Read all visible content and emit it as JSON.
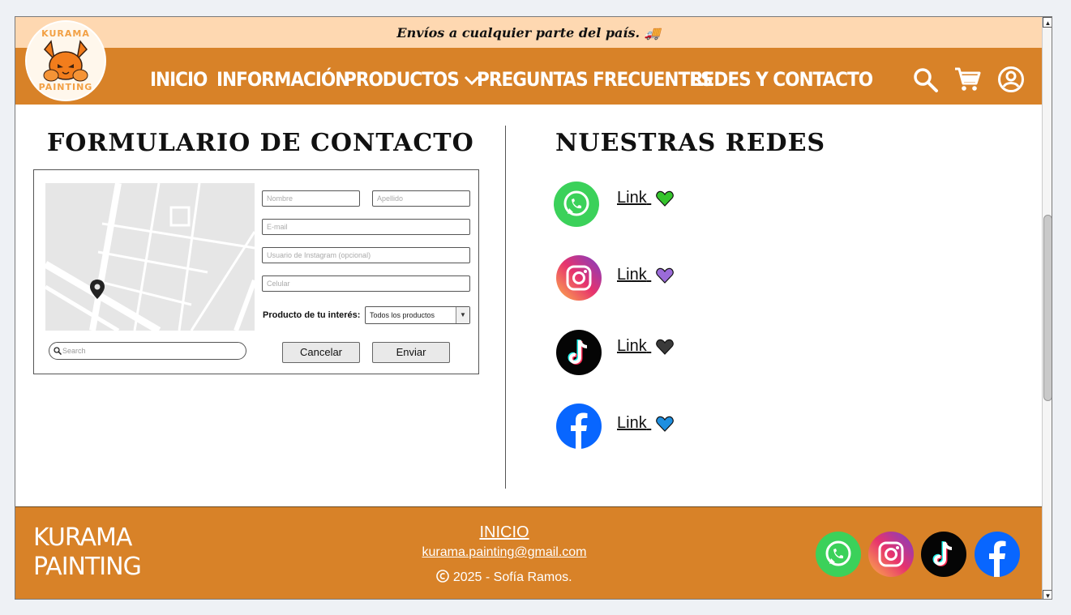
{
  "announcement": "Envíos a cualquier parte del país. 🚚",
  "logo": {
    "top_text": "KURAMA",
    "bottom_text": "PAINTING"
  },
  "nav": {
    "items": [
      "INICIO",
      "INFORMACIÓN",
      "PRODUCTOS",
      "PREGUNTAS FRECUENTES",
      "REDES Y CONTACTO"
    ],
    "icons": [
      "search-icon",
      "cart-icon",
      "account-icon"
    ]
  },
  "contact": {
    "title": "FORMULARIO DE CONTACTO",
    "fields": {
      "nombre": "Nombre",
      "apellido": "Apellido",
      "email": "E-mail",
      "instagram": "Usuario de Instagram (opcional)",
      "celular": "Celular"
    },
    "product_label": "Producto de tu interés:",
    "product_selected": "Todos los productos",
    "search_placeholder": "Search",
    "cancel": "Cancelar",
    "send": "Enviar"
  },
  "social": {
    "title": "NUESTRAS REDES",
    "items": [
      {
        "name": "whatsapp-icon",
        "link": "Link",
        "heart_color": "#35c42c"
      },
      {
        "name": "instagram-icon",
        "link": "Link",
        "heart_color": "#9b6bd8"
      },
      {
        "name": "tiktok-icon",
        "link": "Link",
        "heart_color": "#333333"
      },
      {
        "name": "facebook-icon",
        "link": "Link",
        "heart_color": "#1e8fe0"
      }
    ]
  },
  "footer": {
    "brand_line1": "KURAMA",
    "brand_line2": "PAINTING",
    "home_link": "INICIO",
    "email": "kurama.painting@gmail.com",
    "copyright": "2025 - Sofía Ramos."
  },
  "colors": {
    "accent": "#d88228",
    "banner": "#fed8b1"
  }
}
